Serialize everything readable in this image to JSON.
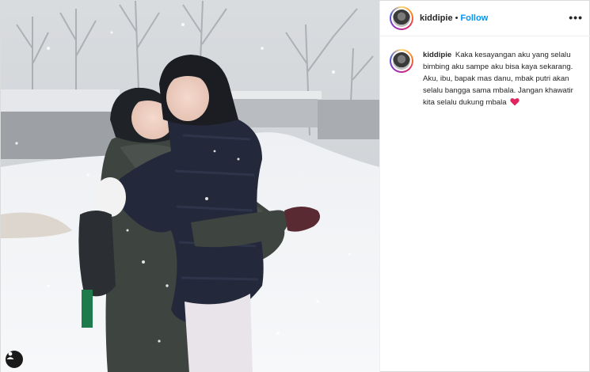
{
  "post": {
    "username": "kiddipie",
    "separator": "•",
    "follow_label": "Follow",
    "more_label": "•••",
    "caption_username": "kiddipie",
    "caption_text": "Kaka kesayangan aku yang selalu bimbing aku sampe aku bisa kaya sekarang. Aku, ibu, bapak mas danu, mbak putri akan selalu bangga sama mbala. Jangan khawatir kita selalu dukung mbala",
    "caption_emoji": "heart-icon"
  },
  "photo": {
    "description_icon": "tagged-user-icon"
  },
  "colors": {
    "follow": "#0095f6",
    "text": "#262626",
    "border": "#dbdbdb"
  }
}
